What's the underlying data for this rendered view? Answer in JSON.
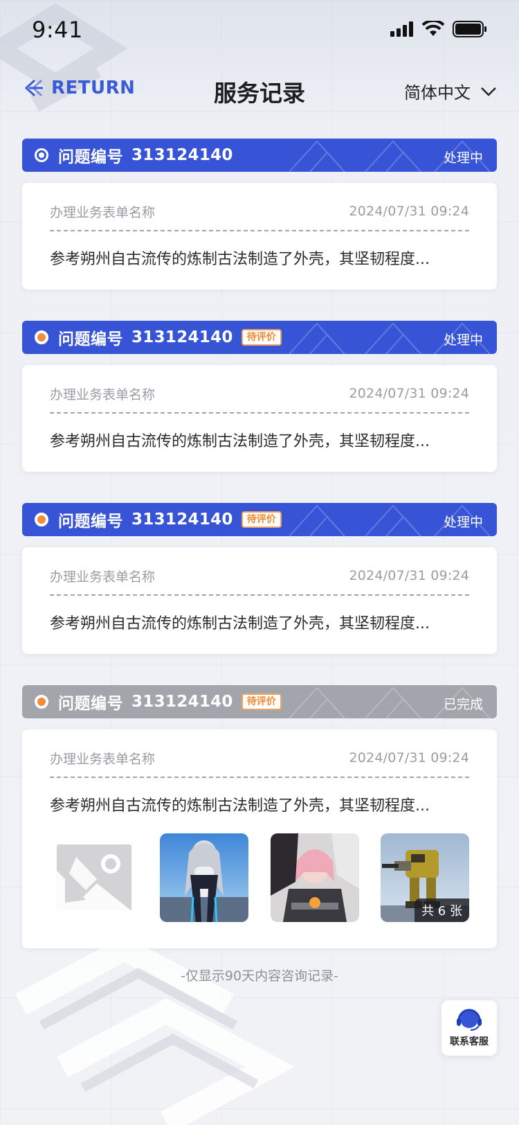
{
  "status_bar": {
    "time": "9:41"
  },
  "nav": {
    "back_label": "RETURN",
    "title": "服务记录",
    "language": "简体中文"
  },
  "records": [
    {
      "label": "问题编号",
      "id": "313124140",
      "badge": "",
      "status": "处理中",
      "form_name": "办理业务表单名称",
      "date": "2024/07/31  09:24",
      "description": "参考朔州自古流传的炼制古法制造了外壳，其坚韧程度..."
    },
    {
      "label": "问题编号",
      "id": "313124140",
      "badge": "待评价",
      "status": "处理中",
      "form_name": "办理业务表单名称",
      "date": "2024/07/31  09:24",
      "description": "参考朔州自古流传的炼制古法制造了外壳，其坚韧程度..."
    },
    {
      "label": "问题编号",
      "id": "313124140",
      "badge": "待评价",
      "status": "处理中",
      "form_name": "办理业务表单名称",
      "date": "2024/07/31  09:24",
      "description": "参考朔州自古流传的炼制古法制造了外壳，其坚韧程度..."
    },
    {
      "label": "问题编号",
      "id": "313124140",
      "badge": "待评价",
      "status": "已完成",
      "form_name": "办理业务表单名称",
      "date": "2024/07/31  09:24",
      "description": "参考朔州自古流传的炼制古法制造了外壳，其坚韧程度...",
      "image_count_label": "共 6 张"
    }
  ],
  "footer_note": "-仅显示90天内容咨询记录-",
  "service_button": {
    "label": "联系客服",
    "icon": "headset-icon"
  },
  "colors": {
    "primary": "#3754d6",
    "completed_header": "#a3a5ad",
    "badge_orange": "#f08a30"
  }
}
